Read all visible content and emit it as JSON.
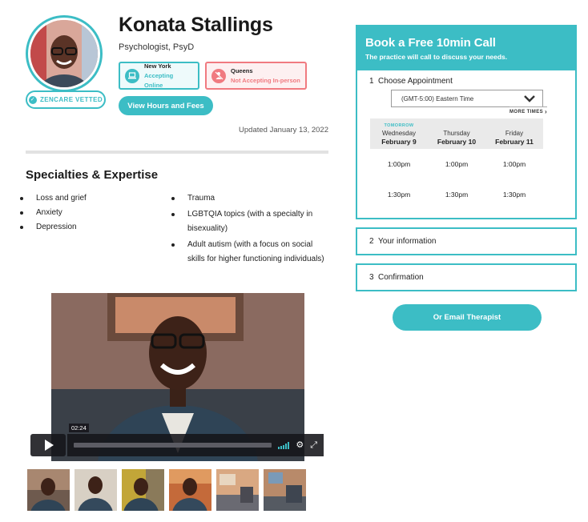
{
  "profile": {
    "name": "Konata Stallings",
    "credentials": "Psychologist, PsyD",
    "vetted_badge": "ZENCARE VETTED",
    "updated": "Updated January 13, 2022"
  },
  "locations": [
    {
      "title": "New York",
      "status": "Accepting Online",
      "icon": "laptop-icon"
    },
    {
      "title": "Queens",
      "status": "Not Accepting In-person",
      "icon": "person-not-allowed-icon"
    }
  ],
  "hours_button": "View Hours and Fees",
  "specialties": {
    "title": "Specialties & Expertise",
    "column1": [
      "Loss and grief",
      "Anxiety",
      "Depression"
    ],
    "column2": [
      "Trauma",
      "LGBTQIA topics (with a specialty in bisexuality)",
      "Adult autism (with a focus on social skills for higher functioning individuals)"
    ]
  },
  "video": {
    "timecode": "02:24"
  },
  "booking": {
    "title": "Book a Free 10min Call",
    "subtitle": "The practice will call to discuss your needs.",
    "steps": [
      {
        "num": "1",
        "label": "Choose Appointment"
      },
      {
        "num": "2",
        "label": "Your information"
      },
      {
        "num": "3",
        "label": "Confirmation"
      }
    ],
    "timezone": "(GMT-5:00) Eastern Time",
    "more_times": "MORE TIMES",
    "days": [
      {
        "tag": "TOMORROW",
        "day": "Wednesday",
        "date": "February 9"
      },
      {
        "tag": "",
        "day": "Thursday",
        "date": "February 10"
      },
      {
        "tag": "",
        "day": "Friday",
        "date": "February 11"
      }
    ],
    "time_rows": [
      [
        "1:00pm",
        "1:00pm",
        "1:00pm"
      ],
      [
        "1:30pm",
        "1:30pm",
        "1:30pm"
      ]
    ]
  },
  "email_button": "Or Email Therapist",
  "colors": {
    "accent": "#3cbdc5",
    "alert": "#f07a80"
  }
}
